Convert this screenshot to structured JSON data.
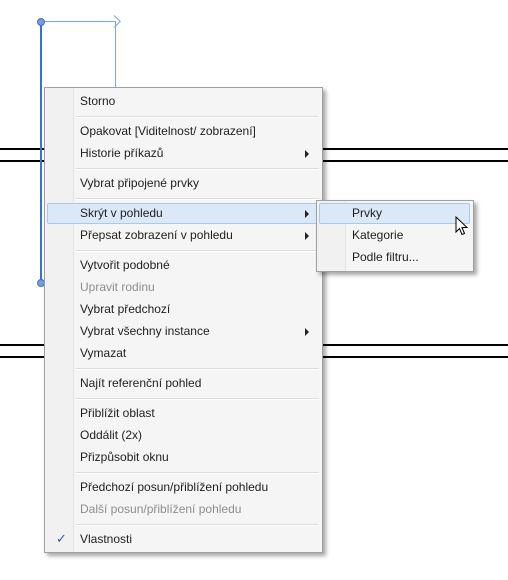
{
  "canvas": {
    "elements": [
      "blue-selected-line",
      "wall-lines-top",
      "wall-lines-bottom"
    ]
  },
  "menu": {
    "items": [
      {
        "label": "Storno",
        "enabled": true
      },
      {
        "label": "Opakovat [Viditelnost/ zobrazení]",
        "enabled": true
      },
      {
        "label": "Historie příkazů",
        "enabled": true,
        "submenu": true
      },
      {
        "label": "Vybrat připojené prvky",
        "enabled": true
      },
      {
        "label": "Skrýt v pohledu",
        "enabled": true,
        "submenu": true,
        "highlighted": true
      },
      {
        "label": "Přepsat zobrazení v pohledu",
        "enabled": true,
        "submenu": true
      },
      {
        "label": "Vytvořit podobné",
        "enabled": true
      },
      {
        "label": "Upravit rodinu",
        "enabled": false
      },
      {
        "label": "Vybrat předchozí",
        "enabled": true
      },
      {
        "label": "Vybrat všechny instance",
        "enabled": true,
        "submenu": true
      },
      {
        "label": "Vymazat",
        "enabled": true
      },
      {
        "label": "Najít referenční pohled",
        "enabled": true
      },
      {
        "label": "Přiblížit oblast",
        "enabled": true
      },
      {
        "label": "Oddálit (2x)",
        "enabled": true
      },
      {
        "label": "Přizpůsobit oknu",
        "enabled": true
      },
      {
        "label": "Předchozí posun/přiblížení pohledu",
        "enabled": true
      },
      {
        "label": "Další posun/přiblížení pohledu",
        "enabled": false
      },
      {
        "label": "Vlastnosti",
        "enabled": true,
        "checked": true
      }
    ],
    "check_glyph": "✓"
  },
  "submenu": {
    "items": [
      {
        "label": "Prvky",
        "highlighted": true
      },
      {
        "label": "Kategorie"
      },
      {
        "label": "Podle filtru..."
      }
    ]
  },
  "colors": {
    "highlight_bg": "#dbe8f8",
    "highlight_border": "#a8c8ec",
    "selection_blue": "#3c6fd0"
  },
  "icons": {
    "submenu_arrow": "chevron-right-icon",
    "cursor": "mouse-pointer-icon",
    "check": "checkmark-icon"
  }
}
